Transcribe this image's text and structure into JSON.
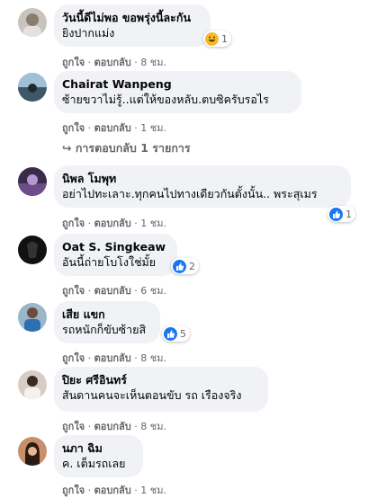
{
  "comments": [
    {
      "author": "วันนี้ดีไม่พอ ขอพรุ่งนี้ละกัน",
      "text": "ยิงปากแม่ง",
      "like": "ถูกใจ",
      "reply": "ตอบกลับ",
      "time": "8 ชม.",
      "reaction_count": "1",
      "reaction": "haha"
    },
    {
      "author": "Chairat Wanpeng",
      "text": "ซ้ายขวาไม่รู้..แต่ให้ของหลับ.ตบซิครับรอไร",
      "like": "ถูกใจ",
      "reply": "ตอบกลับ",
      "time": "1 ชม.",
      "replies_label": "การตอบกลับ 1 รายการ"
    },
    {
      "author": "นิพล โมพุท",
      "text": "อย่าไปทะเลาะ.ทุกคนไปทางเดียวกันตั้งนั้น.. พระสุเมร",
      "like": "ถูกใจ",
      "reply": "ตอบกลับ",
      "time": "1 ชม.",
      "reaction_count": "1",
      "reaction": "like"
    },
    {
      "author": "Oat S. Singkeaw",
      "text": "อันนี้ถ่ายโบโงใช่มั้ย",
      "like": "ถูกใจ",
      "reply": "ตอบกลับ",
      "time": "6 ชม.",
      "reaction_count": "2",
      "reaction": "like"
    },
    {
      "author": "เสีย แขก",
      "text": "รถหนักก็ขับซ้ายสิ",
      "like": "ถูกใจ",
      "reply": "ตอบกลับ",
      "time": "8 ชม.",
      "reaction_count": "5",
      "reaction": "like"
    },
    {
      "author": "ปิยะ ศรีอินทร์",
      "text": "สันดานคนจะเห็นตอนขับ รถ เรืองจริง",
      "like": "ถูกใจ",
      "reply": "ตอบกลับ",
      "time": "8 ชม."
    },
    {
      "author": "นภา ฉิม",
      "text": "ค. เต็มรถเลย",
      "like": "ถูกใจ",
      "reply": "ตอบกลับ",
      "time": "1 ชม."
    }
  ],
  "colors": {
    "bubble": "#f0f2f5",
    "meta": "#65676b",
    "like_blue": "#1877f2",
    "haha_yellow": "#f7b928"
  }
}
